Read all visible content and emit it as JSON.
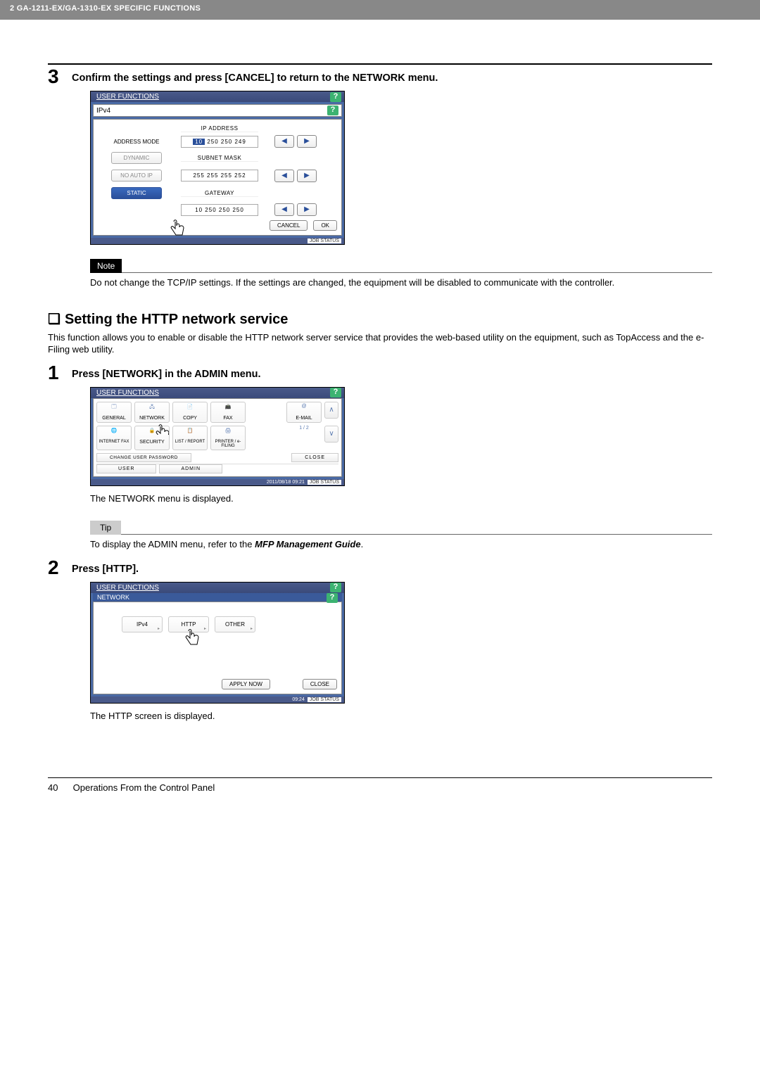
{
  "header": {
    "breadcrumb": "2 GA-1211-EX/GA-1310-EX SPECIFIC FUNCTIONS"
  },
  "step3": {
    "num": "3",
    "title": "Confirm the settings and press [CANCEL] to return to the NETWORK menu.",
    "panel": {
      "title": "USER FUNCTIONS",
      "sub": "IPv4",
      "labels": {
        "address_mode": "ADDRESS MODE",
        "dynamic": "DYNAMIC",
        "no_auto_ip": "NO AUTO IP",
        "static": "STATIC",
        "ip_address": "IP ADDRESS",
        "subnet_mask": "SUBNET MASK",
        "gateway": "GATEWAY"
      },
      "values": {
        "ip1": "10",
        "ip_rest": " 250  250  249",
        "subnet": "255  255  255  252",
        "gateway": "10  250  250  250"
      },
      "buttons": {
        "cancel": "CANCEL",
        "ok": "OK",
        "job_status": "JOB STATUS"
      }
    },
    "note_label": "Note",
    "note_text": "Do not change the TCP/IP settings. If the settings are changed, the equipment will be disabled to communicate with the controller."
  },
  "section_http": {
    "title": "Setting the HTTP network service",
    "intro": "This function allows you to enable or disable the HTTP network server service that provides the web-based utility on the equipment, such as TopAccess and the e-Filing web utility."
  },
  "step1": {
    "num": "1",
    "title": "Press [NETWORK] in the ADMIN menu.",
    "panel": {
      "title": "USER FUNCTIONS",
      "icons_row1": [
        "GENERAL",
        "NETWORK",
        "COPY",
        "FAX",
        "E-MAIL"
      ],
      "icons_row2": [
        "INTERNET FAX",
        "SECURITY",
        "LIST / REPORT",
        "PRINTER / e-FILING"
      ],
      "change_pwd": "CHANGE USER PASSWORD",
      "close": "CLOSE",
      "tab_user": "USER",
      "tab_admin": "ADMIN",
      "page_indicator": "1 / 2",
      "timestamp": "2011/08/18 09:21",
      "job_status": "JOB STATUS"
    },
    "output": "The NETWORK menu is displayed.",
    "tip_label": "Tip",
    "tip_text_a": "To display the ADMIN menu, refer to the ",
    "tip_text_b": "MFP Management Guide",
    "tip_text_c": "."
  },
  "step2": {
    "num": "2",
    "title": "Press [HTTP].",
    "panel": {
      "title": "USER FUNCTIONS",
      "sub": "NETWORK",
      "buttons": [
        "IPv4",
        "HTTP",
        "OTHER"
      ],
      "apply_now": "APPLY NOW",
      "close": "CLOSE",
      "timestamp": "09:24",
      "job_status": "JOB STATUS"
    },
    "output": "The HTTP screen is displayed."
  },
  "footer": {
    "page_num": "40",
    "caption": "Operations From the Control Panel"
  }
}
